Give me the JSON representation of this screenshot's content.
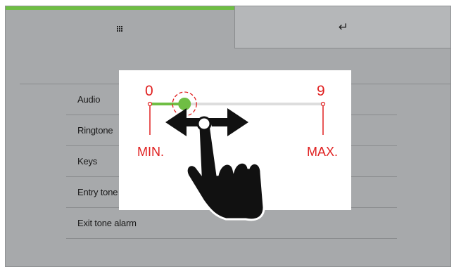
{
  "header": {
    "tabs": [
      {
        "icon": "grid-icon",
        "active": true
      },
      {
        "icon": "return-icon",
        "glyph": "↵",
        "active": false
      }
    ]
  },
  "menu": {
    "items": [
      "Audio",
      "Ringtone",
      "Keys",
      "Entry tone",
      "Exit tone alarm"
    ]
  },
  "slider_overlay": {
    "min_value": "0",
    "max_value": "9",
    "min_label": "MIN.",
    "max_label": "MAX.",
    "current_level": 0.2,
    "gesture_icon": "hand-swipe-icon"
  },
  "colors": {
    "accent": "#6fbe44",
    "annotation": "#e02020",
    "screen_bg": "#a7a9ab"
  }
}
